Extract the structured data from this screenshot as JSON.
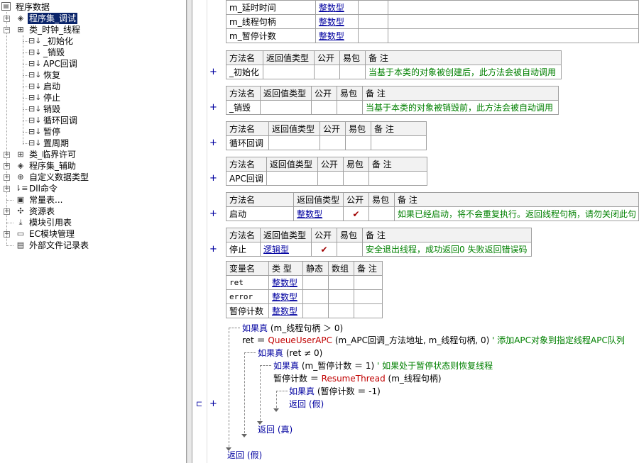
{
  "tree": {
    "root": "程序数据",
    "items": [
      {
        "label": "程序集_调试",
        "icon": "assembly-icon",
        "selected": true
      },
      {
        "label": "类_时钟_线程",
        "icon": "class-icon"
      },
      {
        "label": "_初始化",
        "icon": "method-icon"
      },
      {
        "label": "_销毁",
        "icon": "method-icon"
      },
      {
        "label": "APC回调",
        "icon": "method-icon"
      },
      {
        "label": "恢复",
        "icon": "method-icon"
      },
      {
        "label": "启动",
        "icon": "method-icon"
      },
      {
        "label": "停止",
        "icon": "method-icon"
      },
      {
        "label": "销毁",
        "icon": "method-icon"
      },
      {
        "label": "循环回调",
        "icon": "method-icon"
      },
      {
        "label": "暂停",
        "icon": "method-icon"
      },
      {
        "label": "置周期",
        "icon": "method-icon"
      },
      {
        "label": "类_临界许可",
        "icon": "class-icon"
      },
      {
        "label": "程序集_辅助",
        "icon": "assembly-icon"
      },
      {
        "label": "自定义数据类型",
        "icon": "datatype-icon"
      },
      {
        "label": "Dll命令",
        "icon": "dll-icon"
      },
      {
        "label": "常量表...",
        "icon": "constant-icon"
      },
      {
        "label": "资源表",
        "icon": "resource-icon"
      },
      {
        "label": "模块引用表",
        "icon": "module-icon"
      },
      {
        "label": "EC模块管理",
        "icon": "ec-module-icon"
      },
      {
        "label": "外部文件记录表",
        "icon": "file-icon"
      }
    ]
  },
  "vars_top": [
    {
      "name": "m_延时时间",
      "type": "整数型"
    },
    {
      "name": "m_线程句柄",
      "type": "整数型"
    },
    {
      "name": "m_暂停计数",
      "type": "整数型"
    }
  ],
  "method_headers": {
    "name": "方法名",
    "ret": "返回值类型",
    "public": "公开",
    "easy": "易包",
    "note": "备 注"
  },
  "methods": [
    {
      "name": "_初始化",
      "ret": "",
      "public": "",
      "note": "当基于本类的对象被创建后，此方法会被自动调用"
    },
    {
      "name": "_销毁",
      "ret": "",
      "public": "",
      "note": "当基于本类的对象被销毁前，此方法会被自动调用"
    },
    {
      "name": "循环回调",
      "ret": "",
      "public": "",
      "note": ""
    },
    {
      "name": "APC回调",
      "ret": "",
      "public": "",
      "note": ""
    },
    {
      "name": "启动",
      "ret": "整数型",
      "public": "✔",
      "note": "如果已经启动，将不会重复执行。返回线程句柄，请勿关闭此句"
    },
    {
      "name": "停止",
      "ret": "逻辑型",
      "public": "✔",
      "note": "安全退出线程，成功返回0 失败返回错误码"
    }
  ],
  "local_headers": {
    "name": "变量名",
    "type": "类 型",
    "static": "静态",
    "array": "数组",
    "note": "备 注"
  },
  "locals": [
    {
      "name": "ret",
      "type": "整数型"
    },
    {
      "name": "error",
      "type": "整数型"
    },
    {
      "name": "暂停计数",
      "type": "整数型"
    }
  ],
  "code": {
    "l1_kw": "如果真",
    "l1_rest": " (m_线程句柄 ＞ 0)",
    "l2_a": "ret ＝ ",
    "l2_fn": "QueueUserAPC",
    "l2_b": " (m_APC回调_方法地址, m_线程句柄, 0)  ",
    "l2_cm": "' 添加APC对象到指定线程APC队列",
    "l3_kw": "如果真",
    "l3_rest": " (ret ≠ 0)",
    "l4_kw": "如果真",
    "l4_rest": " (m_暂停计数 ＝ 1)  ",
    "l4_cm": "' 如果处于暂停状态则恢复线程",
    "l5_a": "暂停计数 ＝ ",
    "l5_fn": "ResumeThread",
    "l5_b": " (m_线程句柄)",
    "l6_kw": "如果真",
    "l6_rest": " (暂停计数 ＝ -1)",
    "l7": "返回 (假)",
    "l8": "返回 (真)",
    "l9": "返回 (假)"
  },
  "colors": {
    "selection": "#0a246a",
    "keyword": "#0000a0",
    "function": "#c00000",
    "comment": "#008000"
  }
}
